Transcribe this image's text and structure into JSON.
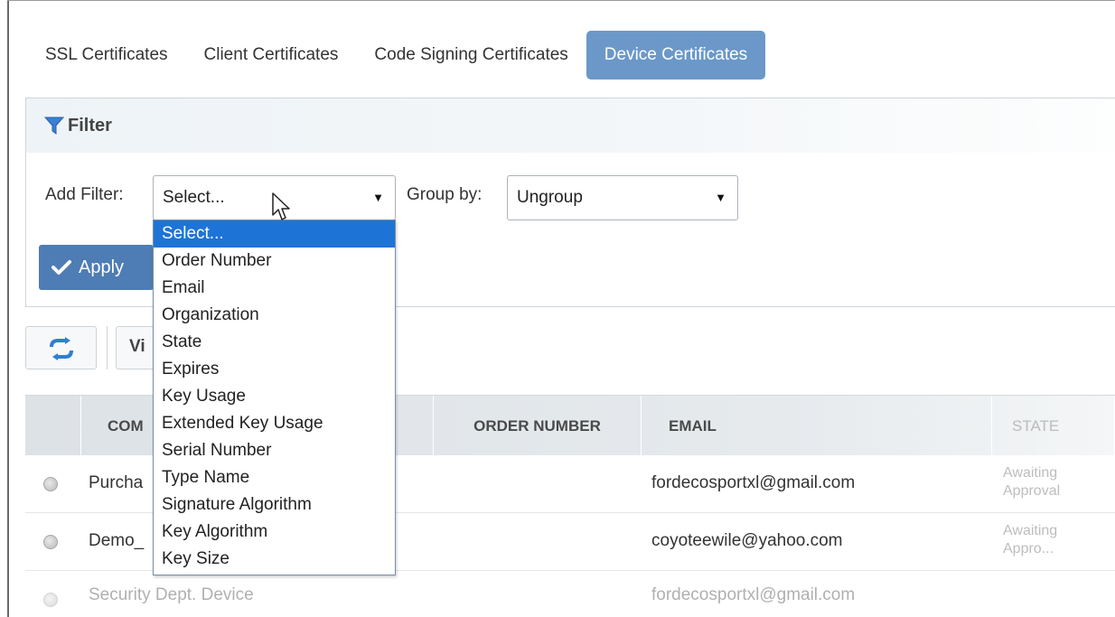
{
  "tabs": [
    {
      "label": "SSL Certificates",
      "active": false
    },
    {
      "label": "Client Certificates",
      "active": false
    },
    {
      "label": "Code Signing Certificates",
      "active": false
    },
    {
      "label": "Device Certificates",
      "active": true
    }
  ],
  "filter": {
    "title": "Filter",
    "add_filter_label": "Add Filter:",
    "add_filter_value": "Select...",
    "group_by_label": "Group by:",
    "group_by_value": "Ungroup",
    "apply_label": "Apply"
  },
  "dropdown": {
    "options": [
      "Select...",
      "Order Number",
      "Email",
      "Organization",
      "State",
      "Expires",
      "Key Usage",
      "Extended Key Usage",
      "Serial Number",
      "Type Name",
      "Signature Algorithm",
      "Key Algorithm",
      "Key Size"
    ],
    "selected_index": 0
  },
  "toolbar": {
    "view_label_partial": "Vi"
  },
  "table": {
    "columns": [
      "COM",
      "ORDER NUMBER",
      "EMAIL",
      "STATE"
    ],
    "rows": [
      {
        "name": "Purcha",
        "email": "fordecosportxl@gmail.com",
        "state_line1": "Awaiting",
        "state_line2": "Approval"
      },
      {
        "name": "Demo_",
        "email": "coyoteewile@yahoo.com",
        "state_line1": "Awaiting",
        "state_line2": "Appro..."
      },
      {
        "name": "Security Dept. Device",
        "email": "fordecosportxl@gmail.com",
        "state_line1": "",
        "state_line2": ""
      }
    ]
  },
  "colors": {
    "active_tab": "#6b98c9",
    "apply_button": "#4e7cb4",
    "dropdown_selected": "#1e74d6"
  }
}
